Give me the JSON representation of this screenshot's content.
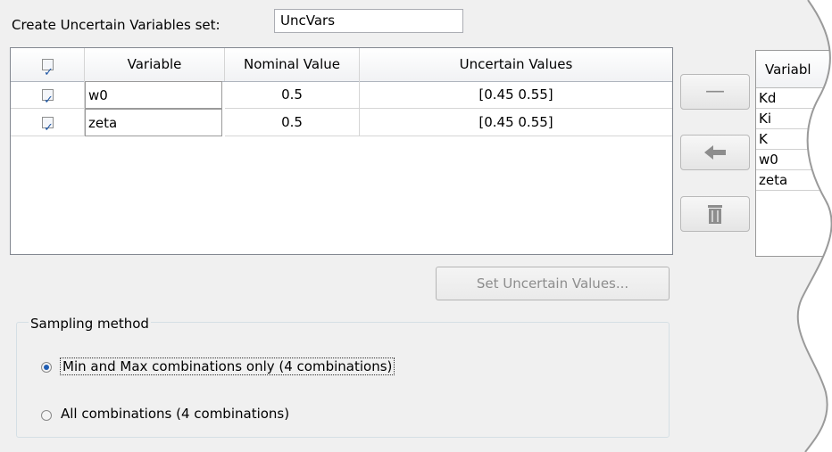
{
  "header": {
    "create_label": "Create Uncertain Variables set:",
    "set_name_value": "UncVars"
  },
  "table": {
    "columns": [
      "",
      "Variable",
      "Nominal Value",
      "Uncertain Values"
    ],
    "rows": [
      {
        "checked": true,
        "variable": "w0",
        "nominal": "0.5",
        "uncertain": "[0.45 0.55]"
      },
      {
        "checked": true,
        "variable": "zeta",
        "nominal": "0.5",
        "uncertain": "[0.45 0.55]"
      }
    ]
  },
  "set_button_label": "Set Uncertain Values...",
  "sampling": {
    "title": "Sampling method",
    "options": [
      {
        "label": "Min and Max combinations only (4 combinations)",
        "selected": true
      },
      {
        "label": "All combinations (4 combinations)",
        "selected": false
      }
    ]
  },
  "middle_buttons": {
    "remove_symbol": "—",
    "move_left_icon": "arrow-left-icon",
    "delete_icon": "trash-icon"
  },
  "right_list": {
    "header": "Variabl",
    "items": [
      "Kd",
      "Ki",
      "K",
      "w0",
      "zeta"
    ]
  }
}
